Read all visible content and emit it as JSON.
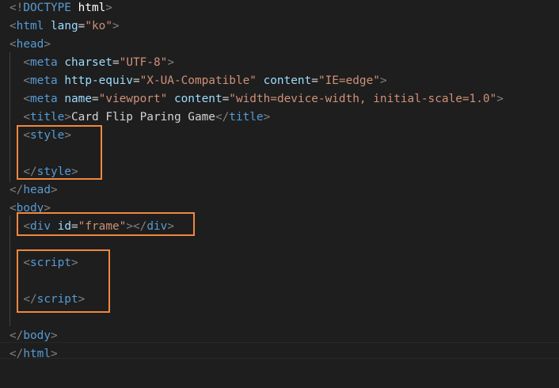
{
  "code": {
    "lines": [
      [
        {
          "c": "t-punct",
          "t": "<!"
        },
        {
          "c": "t-doc",
          "t": "DOCTYPE "
        },
        {
          "c": "t-kw",
          "t": "html"
        },
        {
          "c": "t-punct",
          "t": ">"
        }
      ],
      [
        {
          "c": "t-punct",
          "t": "<"
        },
        {
          "c": "t-tag",
          "t": "html"
        },
        {
          "c": "t-text",
          "t": " "
        },
        {
          "c": "t-attr",
          "t": "lang"
        },
        {
          "c": "t-text",
          "t": "="
        },
        {
          "c": "t-str",
          "t": "\"ko\""
        },
        {
          "c": "t-punct",
          "t": ">"
        }
      ],
      [
        {
          "c": "t-punct",
          "t": "<"
        },
        {
          "c": "t-tag",
          "t": "head"
        },
        {
          "c": "t-punct",
          "t": ">"
        }
      ],
      [
        {
          "c": "t-text",
          "t": "  "
        },
        {
          "c": "t-punct",
          "t": "<"
        },
        {
          "c": "t-tag",
          "t": "meta"
        },
        {
          "c": "t-text",
          "t": " "
        },
        {
          "c": "t-attr",
          "t": "charset"
        },
        {
          "c": "t-text",
          "t": "="
        },
        {
          "c": "t-str",
          "t": "\"UTF-8\""
        },
        {
          "c": "t-punct",
          "t": ">"
        }
      ],
      [
        {
          "c": "t-text",
          "t": "  "
        },
        {
          "c": "t-punct",
          "t": "<"
        },
        {
          "c": "t-tag",
          "t": "meta"
        },
        {
          "c": "t-text",
          "t": " "
        },
        {
          "c": "t-attr",
          "t": "http-equiv"
        },
        {
          "c": "t-text",
          "t": "="
        },
        {
          "c": "t-str",
          "t": "\"X-UA-Compatible\""
        },
        {
          "c": "t-text",
          "t": " "
        },
        {
          "c": "t-attr",
          "t": "content"
        },
        {
          "c": "t-text",
          "t": "="
        },
        {
          "c": "t-str",
          "t": "\"IE=edge\""
        },
        {
          "c": "t-punct",
          "t": ">"
        }
      ],
      [
        {
          "c": "t-text",
          "t": "  "
        },
        {
          "c": "t-punct",
          "t": "<"
        },
        {
          "c": "t-tag",
          "t": "meta"
        },
        {
          "c": "t-text",
          "t": " "
        },
        {
          "c": "t-attr",
          "t": "name"
        },
        {
          "c": "t-text",
          "t": "="
        },
        {
          "c": "t-str",
          "t": "\"viewport\""
        },
        {
          "c": "t-text",
          "t": " "
        },
        {
          "c": "t-attr",
          "t": "content"
        },
        {
          "c": "t-text",
          "t": "="
        },
        {
          "c": "t-str",
          "t": "\"width=device-width, initial-scale=1.0\""
        },
        {
          "c": "t-punct",
          "t": ">"
        }
      ],
      [
        {
          "c": "t-text",
          "t": "  "
        },
        {
          "c": "t-punct",
          "t": "<"
        },
        {
          "c": "t-tag",
          "t": "title"
        },
        {
          "c": "t-punct",
          "t": ">"
        },
        {
          "c": "t-text",
          "t": "Card Flip Paring Game"
        },
        {
          "c": "t-punct",
          "t": "</"
        },
        {
          "c": "t-tag",
          "t": "title"
        },
        {
          "c": "t-punct",
          "t": ">"
        }
      ],
      [
        {
          "c": "t-text",
          "t": "  "
        },
        {
          "c": "t-punct",
          "t": "<"
        },
        {
          "c": "t-tag",
          "t": "style"
        },
        {
          "c": "t-punct",
          "t": ">"
        }
      ],
      [],
      [
        {
          "c": "t-text",
          "t": "  "
        },
        {
          "c": "t-punct",
          "t": "</"
        },
        {
          "c": "t-tag",
          "t": "style"
        },
        {
          "c": "t-punct",
          "t": ">"
        }
      ],
      [
        {
          "c": "t-punct",
          "t": "</"
        },
        {
          "c": "t-tag",
          "t": "head"
        },
        {
          "c": "t-punct",
          "t": ">"
        }
      ],
      [
        {
          "c": "t-punct",
          "t": "<"
        },
        {
          "c": "t-tag",
          "t": "body"
        },
        {
          "c": "t-punct",
          "t": ">"
        }
      ],
      [
        {
          "c": "t-text",
          "t": "  "
        },
        {
          "c": "t-punct",
          "t": "<"
        },
        {
          "c": "t-tag",
          "t": "div"
        },
        {
          "c": "t-text",
          "t": " "
        },
        {
          "c": "t-attr",
          "t": "id"
        },
        {
          "c": "t-text",
          "t": "="
        },
        {
          "c": "t-str",
          "t": "\"frame\""
        },
        {
          "c": "t-punct",
          "t": "></"
        },
        {
          "c": "t-tag",
          "t": "div"
        },
        {
          "c": "t-punct",
          "t": ">"
        }
      ],
      [],
      [
        {
          "c": "t-text",
          "t": "  "
        },
        {
          "c": "t-punct",
          "t": "<"
        },
        {
          "c": "t-tag",
          "t": "script"
        },
        {
          "c": "t-punct",
          "t": ">"
        }
      ],
      [],
      [
        {
          "c": "t-text",
          "t": "  "
        },
        {
          "c": "t-punct",
          "t": "</"
        },
        {
          "c": "t-tag",
          "t": "script"
        },
        {
          "c": "t-punct",
          "t": ">"
        }
      ],
      [],
      [
        {
          "c": "t-punct",
          "t": "</"
        },
        {
          "c": "t-tag",
          "t": "body"
        },
        {
          "c": "t-punct",
          "t": ">"
        }
      ],
      [
        {
          "c": "t-punct",
          "t": "</"
        },
        {
          "c": "t-tag",
          "t": "html"
        },
        {
          "c": "t-punct",
          "t": ">"
        }
      ]
    ]
  },
  "colors": {
    "background": "#1e1e1e",
    "tag": "#569cd6",
    "attribute": "#9cdcfe",
    "string": "#ce9178",
    "punctuation": "#808080",
    "text": "#d4d4d4",
    "highlight_border": "#f0883e"
  },
  "highlights": [
    "style-block",
    "frame-div",
    "script-block"
  ]
}
